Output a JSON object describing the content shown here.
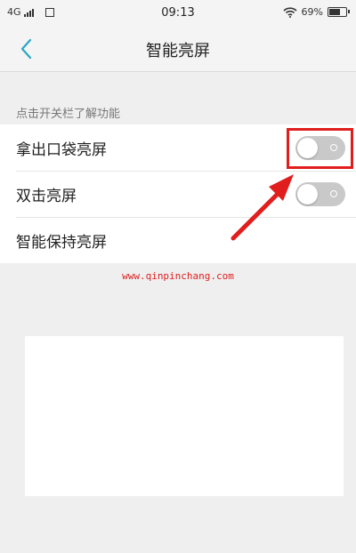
{
  "status_bar": {
    "network": "4G",
    "time": "09:13",
    "battery": "69%",
    "battery_level": 0.69,
    "icons": [
      "signal-icon",
      "sim-icon",
      "wifi-icon",
      "battery-icon"
    ]
  },
  "nav": {
    "back_icon": "chevron-left-icon",
    "title": "智能亮屏"
  },
  "section_header": "点击开关栏了解功能",
  "settings": [
    {
      "label": "拿出口袋亮屏",
      "toggle": "off"
    },
    {
      "label": "双击亮屏",
      "toggle": "off"
    },
    {
      "label": "智能保持亮屏"
    }
  ],
  "watermark": "www.qinpinchang.com",
  "colors": {
    "accent": "#2aa7c5",
    "highlight": "#e01e1e",
    "toggle_off": "#c9c9c9"
  }
}
